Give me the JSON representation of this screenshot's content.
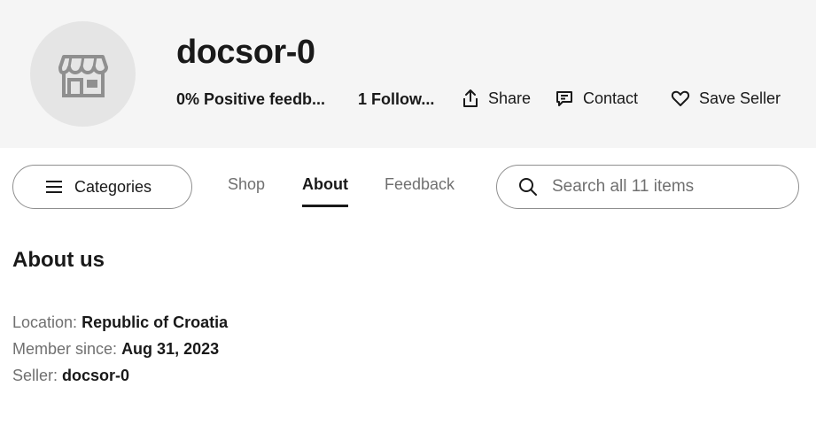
{
  "store": {
    "title": "docsor-0",
    "feedback": "0% Positive feedb...",
    "followers": "1 Follow..."
  },
  "actions": {
    "share": "Share",
    "contact": "Contact",
    "save": "Save Seller"
  },
  "nav": {
    "categories": "Categories",
    "tabs": [
      {
        "label": "Shop",
        "active": false
      },
      {
        "label": "About",
        "active": true
      },
      {
        "label": "Feedback",
        "active": false
      }
    ]
  },
  "search": {
    "placeholder": "Search all 11 items"
  },
  "about": {
    "heading": "About us",
    "rows": [
      {
        "label": "Location:",
        "value": "Republic of Croatia"
      },
      {
        "label": "Member since:",
        "value": "Aug 31, 2023"
      },
      {
        "label": "Seller:",
        "value": "docsor-0"
      }
    ]
  },
  "icons": {
    "avatar": "store-icon",
    "share": "share-icon",
    "contact": "message-icon",
    "save": "heart-icon",
    "categories": "menu-icon",
    "search": "search-icon"
  },
  "colors": {
    "header_bg": "#f5f5f5",
    "avatar_bg": "#e5e5e5",
    "text": "#191919",
    "muted": "#707070",
    "border": "#8f8f8f"
  }
}
